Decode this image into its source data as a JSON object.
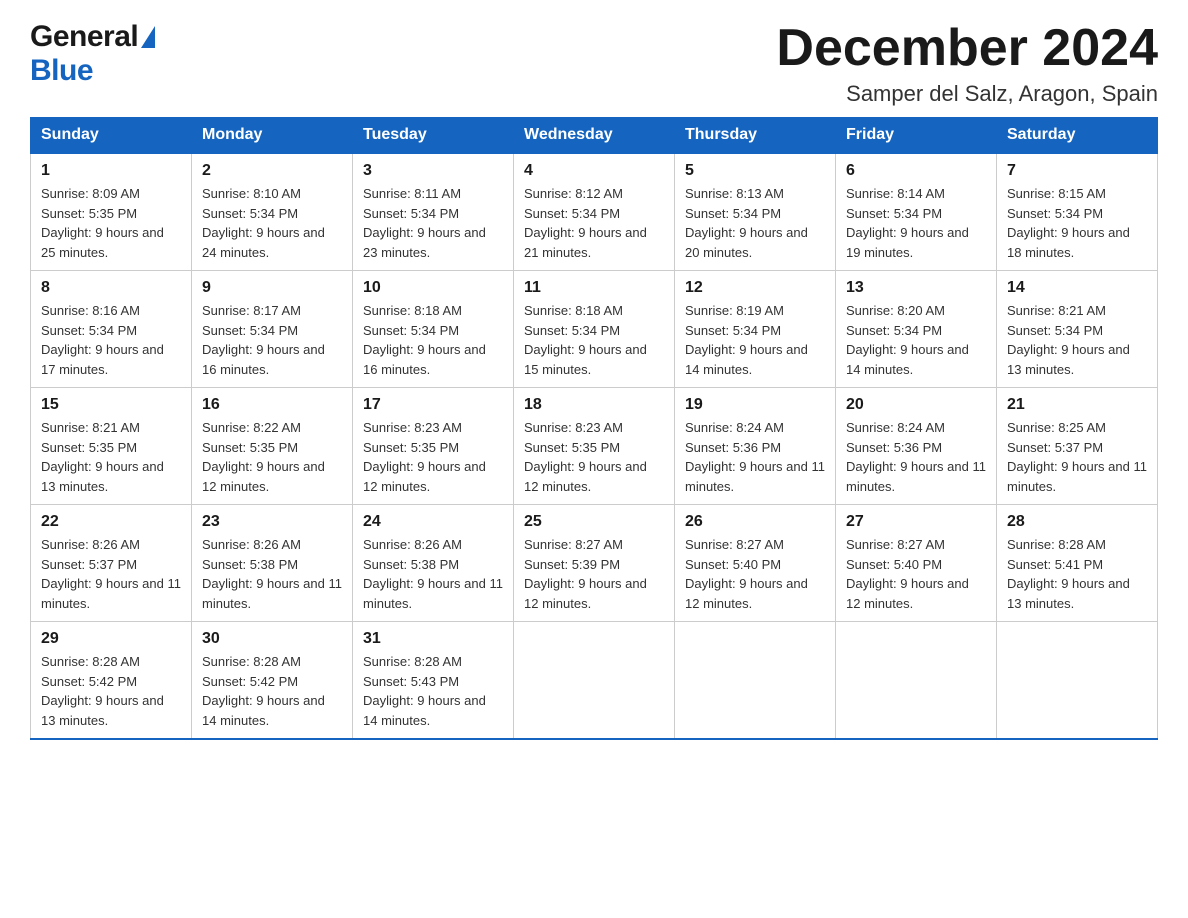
{
  "logo": {
    "general": "General",
    "blue": "Blue",
    "triangle": "▲"
  },
  "title": {
    "month": "December 2024",
    "location": "Samper del Salz, Aragon, Spain"
  },
  "days_of_week": [
    "Sunday",
    "Monday",
    "Tuesday",
    "Wednesday",
    "Thursday",
    "Friday",
    "Saturday"
  ],
  "weeks": [
    [
      {
        "day": "1",
        "sunrise": "Sunrise: 8:09 AM",
        "sunset": "Sunset: 5:35 PM",
        "daylight": "Daylight: 9 hours and 25 minutes."
      },
      {
        "day": "2",
        "sunrise": "Sunrise: 8:10 AM",
        "sunset": "Sunset: 5:34 PM",
        "daylight": "Daylight: 9 hours and 24 minutes."
      },
      {
        "day": "3",
        "sunrise": "Sunrise: 8:11 AM",
        "sunset": "Sunset: 5:34 PM",
        "daylight": "Daylight: 9 hours and 23 minutes."
      },
      {
        "day": "4",
        "sunrise": "Sunrise: 8:12 AM",
        "sunset": "Sunset: 5:34 PM",
        "daylight": "Daylight: 9 hours and 21 minutes."
      },
      {
        "day": "5",
        "sunrise": "Sunrise: 8:13 AM",
        "sunset": "Sunset: 5:34 PM",
        "daylight": "Daylight: 9 hours and 20 minutes."
      },
      {
        "day": "6",
        "sunrise": "Sunrise: 8:14 AM",
        "sunset": "Sunset: 5:34 PM",
        "daylight": "Daylight: 9 hours and 19 minutes."
      },
      {
        "day": "7",
        "sunrise": "Sunrise: 8:15 AM",
        "sunset": "Sunset: 5:34 PM",
        "daylight": "Daylight: 9 hours and 18 minutes."
      }
    ],
    [
      {
        "day": "8",
        "sunrise": "Sunrise: 8:16 AM",
        "sunset": "Sunset: 5:34 PM",
        "daylight": "Daylight: 9 hours and 17 minutes."
      },
      {
        "day": "9",
        "sunrise": "Sunrise: 8:17 AM",
        "sunset": "Sunset: 5:34 PM",
        "daylight": "Daylight: 9 hours and 16 minutes."
      },
      {
        "day": "10",
        "sunrise": "Sunrise: 8:18 AM",
        "sunset": "Sunset: 5:34 PM",
        "daylight": "Daylight: 9 hours and 16 minutes."
      },
      {
        "day": "11",
        "sunrise": "Sunrise: 8:18 AM",
        "sunset": "Sunset: 5:34 PM",
        "daylight": "Daylight: 9 hours and 15 minutes."
      },
      {
        "day": "12",
        "sunrise": "Sunrise: 8:19 AM",
        "sunset": "Sunset: 5:34 PM",
        "daylight": "Daylight: 9 hours and 14 minutes."
      },
      {
        "day": "13",
        "sunrise": "Sunrise: 8:20 AM",
        "sunset": "Sunset: 5:34 PM",
        "daylight": "Daylight: 9 hours and 14 minutes."
      },
      {
        "day": "14",
        "sunrise": "Sunrise: 8:21 AM",
        "sunset": "Sunset: 5:34 PM",
        "daylight": "Daylight: 9 hours and 13 minutes."
      }
    ],
    [
      {
        "day": "15",
        "sunrise": "Sunrise: 8:21 AM",
        "sunset": "Sunset: 5:35 PM",
        "daylight": "Daylight: 9 hours and 13 minutes."
      },
      {
        "day": "16",
        "sunrise": "Sunrise: 8:22 AM",
        "sunset": "Sunset: 5:35 PM",
        "daylight": "Daylight: 9 hours and 12 minutes."
      },
      {
        "day": "17",
        "sunrise": "Sunrise: 8:23 AM",
        "sunset": "Sunset: 5:35 PM",
        "daylight": "Daylight: 9 hours and 12 minutes."
      },
      {
        "day": "18",
        "sunrise": "Sunrise: 8:23 AM",
        "sunset": "Sunset: 5:35 PM",
        "daylight": "Daylight: 9 hours and 12 minutes."
      },
      {
        "day": "19",
        "sunrise": "Sunrise: 8:24 AM",
        "sunset": "Sunset: 5:36 PM",
        "daylight": "Daylight: 9 hours and 11 minutes."
      },
      {
        "day": "20",
        "sunrise": "Sunrise: 8:24 AM",
        "sunset": "Sunset: 5:36 PM",
        "daylight": "Daylight: 9 hours and 11 minutes."
      },
      {
        "day": "21",
        "sunrise": "Sunrise: 8:25 AM",
        "sunset": "Sunset: 5:37 PM",
        "daylight": "Daylight: 9 hours and 11 minutes."
      }
    ],
    [
      {
        "day": "22",
        "sunrise": "Sunrise: 8:26 AM",
        "sunset": "Sunset: 5:37 PM",
        "daylight": "Daylight: 9 hours and 11 minutes."
      },
      {
        "day": "23",
        "sunrise": "Sunrise: 8:26 AM",
        "sunset": "Sunset: 5:38 PM",
        "daylight": "Daylight: 9 hours and 11 minutes."
      },
      {
        "day": "24",
        "sunrise": "Sunrise: 8:26 AM",
        "sunset": "Sunset: 5:38 PM",
        "daylight": "Daylight: 9 hours and 11 minutes."
      },
      {
        "day": "25",
        "sunrise": "Sunrise: 8:27 AM",
        "sunset": "Sunset: 5:39 PM",
        "daylight": "Daylight: 9 hours and 12 minutes."
      },
      {
        "day": "26",
        "sunrise": "Sunrise: 8:27 AM",
        "sunset": "Sunset: 5:40 PM",
        "daylight": "Daylight: 9 hours and 12 minutes."
      },
      {
        "day": "27",
        "sunrise": "Sunrise: 8:27 AM",
        "sunset": "Sunset: 5:40 PM",
        "daylight": "Daylight: 9 hours and 12 minutes."
      },
      {
        "day": "28",
        "sunrise": "Sunrise: 8:28 AM",
        "sunset": "Sunset: 5:41 PM",
        "daylight": "Daylight: 9 hours and 13 minutes."
      }
    ],
    [
      {
        "day": "29",
        "sunrise": "Sunrise: 8:28 AM",
        "sunset": "Sunset: 5:42 PM",
        "daylight": "Daylight: 9 hours and 13 minutes."
      },
      {
        "day": "30",
        "sunrise": "Sunrise: 8:28 AM",
        "sunset": "Sunset: 5:42 PM",
        "daylight": "Daylight: 9 hours and 14 minutes."
      },
      {
        "day": "31",
        "sunrise": "Sunrise: 8:28 AM",
        "sunset": "Sunset: 5:43 PM",
        "daylight": "Daylight: 9 hours and 14 minutes."
      },
      null,
      null,
      null,
      null
    ]
  ]
}
